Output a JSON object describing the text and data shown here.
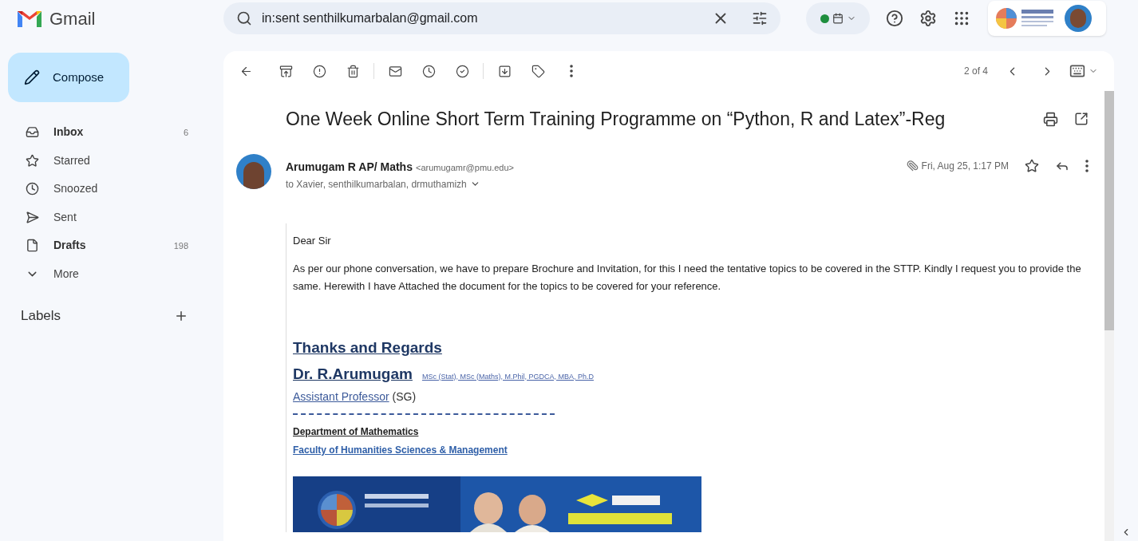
{
  "app": {
    "name": "Gmail"
  },
  "search": {
    "value": "in:sent senthilkumarbalan@gmail.com"
  },
  "compose": {
    "label": "Compose"
  },
  "sidebar": {
    "items": [
      {
        "kind": "inbox",
        "label": "Inbox",
        "count": "6",
        "unread": true
      },
      {
        "kind": "starred",
        "label": "Starred",
        "unread": false
      },
      {
        "kind": "snoozed",
        "label": "Snoozed",
        "unread": false
      },
      {
        "kind": "sent",
        "label": "Sent",
        "unread": false
      },
      {
        "kind": "drafts",
        "label": "Drafts",
        "count": "198",
        "unread": true
      },
      {
        "kind": "more",
        "label": "More",
        "unread": false
      }
    ],
    "labels_heading": "Labels"
  },
  "toolbar": {
    "pager": "2 of 4"
  },
  "message": {
    "subject": "One Week Online Short Term Training Programme on “Python, R and Latex”-Reg",
    "sender_name": "Arumugam R AP/ Maths",
    "sender_email": "<arumugamr@pmu.edu>",
    "recipients": "to Xavier, senthilkumarbalan, drmuthamizh",
    "date": "Fri, Aug 25, 1:17 PM",
    "has_attachment": true,
    "starred": false,
    "body": {
      "greeting": "Dear Sir",
      "paragraph": "As per our phone conversation, we have to prepare Brochure and Invitation, for this I need the tentative topics to be covered in the STTP. Kindly I request you to provide the same.  Herewith I have Attached the document for the topics to be covered for your reference.",
      "signature": {
        "closing": "Thanks and Regards",
        "name": "Dr. R.Arumugam",
        "degrees": "MSc (Stat), MSc (Maths), M.Phil, PGDCA, MBA, Ph.D",
        "title_link": "Assistant Professor",
        "title_suffix": "(SG)",
        "department": "Department of Mathematics",
        "faculty": "Faculty of Humanities Sciences & Management"
      }
    }
  }
}
